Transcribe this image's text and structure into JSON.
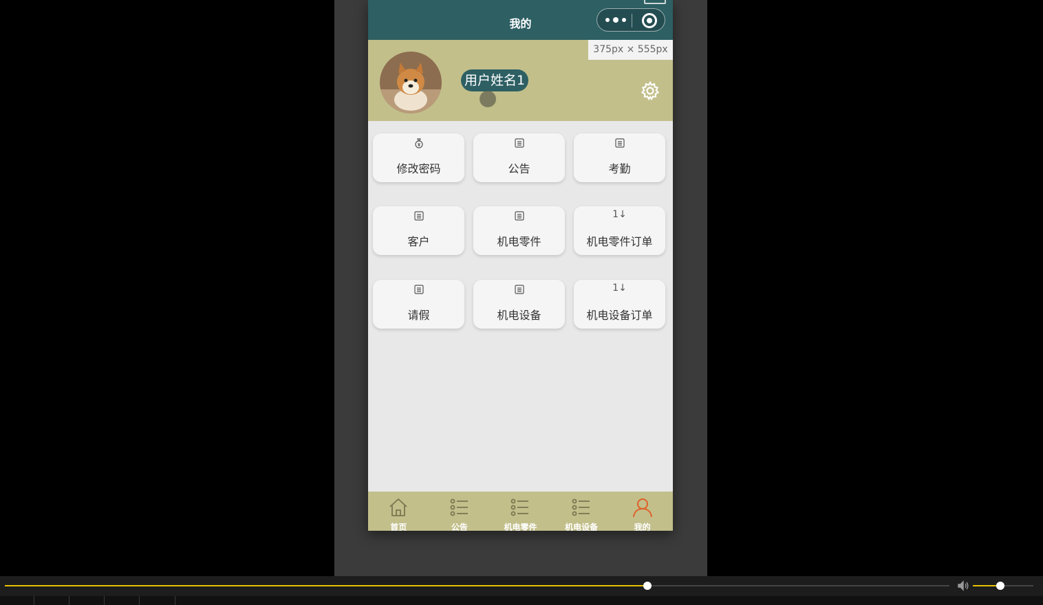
{
  "navbar": {
    "title": "我的"
  },
  "size_tip": "375px × 555px",
  "profile": {
    "username": "用户姓名1",
    "avatar": "shiba-dog-avatar"
  },
  "menu": [
    {
      "label": "修改密码",
      "icon": "money-bag-icon"
    },
    {
      "label": "公告",
      "icon": "list-doc-icon"
    },
    {
      "label": "考勤",
      "icon": "list-doc-icon"
    },
    {
      "label": "客户",
      "icon": "list-doc-icon"
    },
    {
      "label": "机电零件",
      "icon": "list-doc-icon"
    },
    {
      "label": "机电零件订单",
      "icon": "sort-icon",
      "glyph": "1↓"
    },
    {
      "label": "请假",
      "icon": "list-doc-icon"
    },
    {
      "label": "机电设备",
      "icon": "list-doc-icon"
    },
    {
      "label": "机电设备订单",
      "icon": "sort-icon",
      "glyph": "1↓"
    }
  ],
  "tabbar": [
    {
      "label": "首页",
      "icon": "home-icon"
    },
    {
      "label": "公告",
      "icon": "list-icon"
    },
    {
      "label": "机电零件",
      "icon": "list-icon"
    },
    {
      "label": "机电设备",
      "icon": "list-icon"
    },
    {
      "label": "我的",
      "icon": "user-icon",
      "active": true
    }
  ],
  "colors": {
    "navbar": "#2d5f63",
    "header": "#c2bf8b",
    "tabbar": "#c2bf8b",
    "tab_active": "#e0602a",
    "progress": "#e6c100"
  },
  "player": {
    "progress": 0.68,
    "volume": 0.45
  }
}
